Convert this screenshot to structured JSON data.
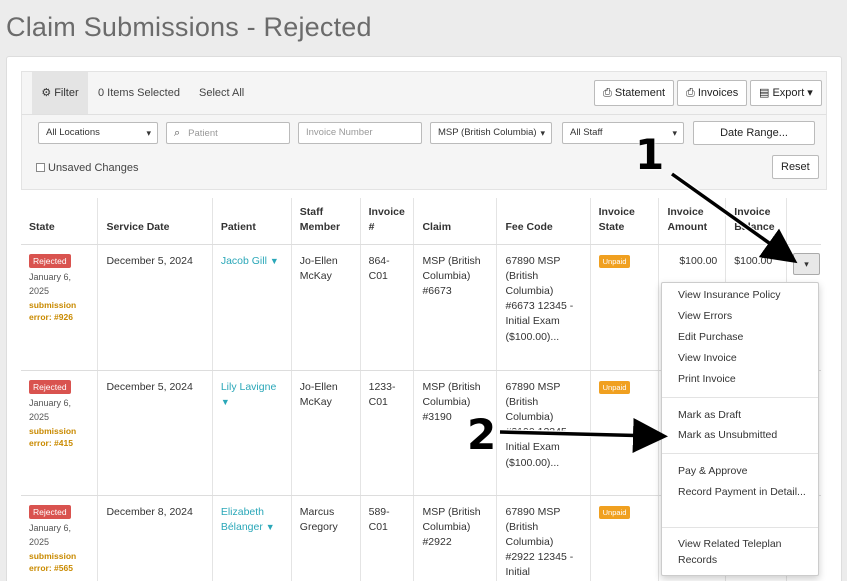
{
  "page": {
    "title": "Claim Submissions - Rejected"
  },
  "toolbar": {
    "filter_label": "Filter",
    "selected_count": "0 Items Selected",
    "select_all": "Select All",
    "statement": "Statement",
    "invoices": "Invoices",
    "export": "Export"
  },
  "filters": {
    "locations": "All Locations",
    "patient_placeholder": "Patient",
    "invoice_placeholder": "Invoice Number",
    "insurer": "MSP (British Columbia)",
    "staff": "All Staff",
    "date_range": "Date Range...",
    "unsaved": "Unsaved Changes",
    "reset": "Reset"
  },
  "table": {
    "headers": [
      "State",
      "Service Date",
      "Patient",
      "Staff Member",
      "Invoice #",
      "Claim",
      "Fee Code",
      "Invoice State",
      "Invoice Amount",
      "Invoice Balance"
    ],
    "rows": [
      {
        "state": "Rejected",
        "state_date": "January 6, 2025",
        "error": "submission error: #926",
        "service_date": "December 5, 2024",
        "patient": "Jacob Gill",
        "staff": "Jo-Ellen McKay",
        "invoice": "864-C01",
        "claim": "MSP (British Columbia) #6673",
        "fee_code": "67890 MSP (British Columbia) #6673 12345 - Initial Exam ($100.00)...",
        "invoice_state": "Unpaid",
        "amount": "$100.00",
        "balance": "$100.00"
      },
      {
        "state": "Rejected",
        "state_date": "January 6, 2025",
        "error": "submission error: #415",
        "service_date": "December 5, 2024",
        "patient": "Lily Lavigne",
        "staff": "Jo-Ellen McKay",
        "invoice": "1233-C01",
        "claim": "MSP (British Columbia) #3190",
        "fee_code": "67890 MSP (British Columbia) #3190 12345 - Initial Exam ($100.00)...",
        "invoice_state": "Unpaid",
        "amount": "",
        "balance": ""
      },
      {
        "state": "Rejected",
        "state_date": "January 6, 2025",
        "error": "submission error: #565",
        "service_date": "December 8, 2024",
        "patient": "Elizabeth Bélanger",
        "staff": "Marcus Gregory",
        "invoice": "589-C01",
        "claim": "MSP (British Columbia) #2922",
        "fee_code": "67890 MSP (British Columbia) #2922 12345 - Initial",
        "invoice_state": "Unpaid",
        "amount": "",
        "balance": ""
      }
    ]
  },
  "menu": {
    "items": [
      "View Insurance Policy",
      "View Errors",
      "Edit Purchase",
      "View Invoice",
      "Print Invoice",
      "Mark as Draft",
      "Mark as Unsubmitted",
      "Pay & Approve",
      "Record Payment in Detail...",
      "View Related Teleplan Records"
    ]
  },
  "callouts": {
    "one": "1",
    "two": "2"
  }
}
